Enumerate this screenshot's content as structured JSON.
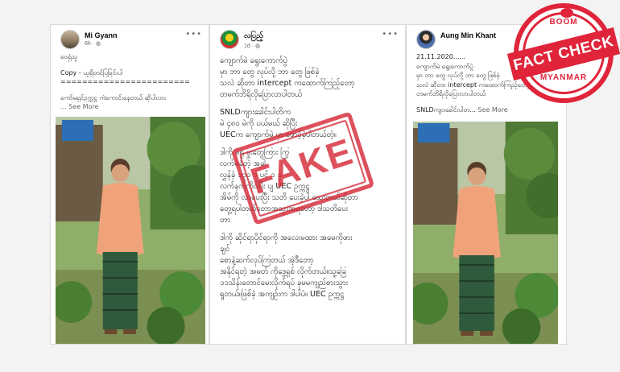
{
  "posts": [
    {
      "author": "Mi Gyann",
      "meta": "6h · ",
      "avatar": "profile-photo",
      "lines": [
        "ဝေရှံသူ",
        "",
        "Copy - ယူရှိတင်ပြခြင်းပါ",
        "========================",
        "",
        "ကော်မရှင်ဥက္ကဋ္ဌ ကဲကောင်းနေတယ် ဆိုပါလား"
      ],
      "see_more": "... See More",
      "photo": "man-in-garden"
    },
    {
      "author": "လပြည့်",
      "meta": "1d · ",
      "avatar": "party-flag-logo",
      "lines": [
        "ကျောက်မဲ ရွေးကောက်ပွဲ",
        "မှာ ဘာ တွေ လုပ်လို့ ဘာ တွေ ဖြစ်ခဲ့",
        "သလဲ ဆိုတာ intercept ကထောက်ကြည့်တော့",
        "တမက်ဘိရိလိုပြောလာပါတယ်",
        "",
        " SNLDကျားခေါင်းပါတိက",
        "မဲ ၄၈၀ မဲကို ပယ်မယ် ဆိုပြီး",
        "UECက ကျောက်မဲ မှာ ဖောင့်ခဲ့ပါတယ်တဲ့။",
        "",
        "ဒါကို မဲရုံ မှူးတွေကြား ကြွ",
        "လက်မခံတဲ့ အခါ",
        "လွှန်ခဲ့ ၁၃၀ ၁ ပင် ၁ ခု",
        "လက်နက်ကိုင်ပြီး ပျ UEC ဥက္ကဋ္ဌ",
        "အိမ်ကို လာပေးပြီး သတိ ပေးခဲ့ပါ သေးတယ်ဆိုတာ",
        "တွေ့ရပါတယ်တော့အထွာအရတော့ ဒါသတိပေး",
        "တာ",
        "",
        "ဒါကို ဆိုင်ရာပိုင်ရာကို အလေးမထား အမေကိုဖား",
        "ချင်",
        "စောနဲ့ဆက်လုပ်ကြတယ် အဲ့ဒီတော့",
        "အနိုင်ရတဲ့ အမတ် ကိုဒွေ့ရှစ် လိုက်တယ်။သူ့ခြေ",
        "၁၁သိန်းတောင်မေးလိုက်ရပ် ခုမမကျည်စားသွား",
        "ရှုတယ်။ဖြစ်ခဲ့ အကျဉ်းက ဒါပါပဲ။ UEC ဥက္ကဋ္ဌ"
      ],
      "see_more": "",
      "photo": ""
    },
    {
      "author": "Aung Min Khant",
      "meta": "",
      "avatar": "profile-photo",
      "lines": [
        "21.11.2020......",
        "ကျောက်မဲ ရွေးကောက်ပွဲ",
        "မှာ ဘာ တွေ လုပ်လို့ ဘာ တွေ ဖြစ်ခဲ့",
        "သလဲ ဆိုတာ intercept ကထောက်ကြည့်တော့",
        "တမက်ဘိရိလိုပြောလာပါတယ်",
        "",
        "SNLDကျားခေါင်းပါတ..."
      ],
      "see_more": " See More",
      "photo": "man-in-garden"
    }
  ],
  "stamp": {
    "text": "FAKE",
    "color": "#d4212f"
  },
  "badge": {
    "top": "BOOM",
    "banner": "FACT CHECK",
    "bottom": "MYANMAR",
    "color": "#e0243a"
  }
}
